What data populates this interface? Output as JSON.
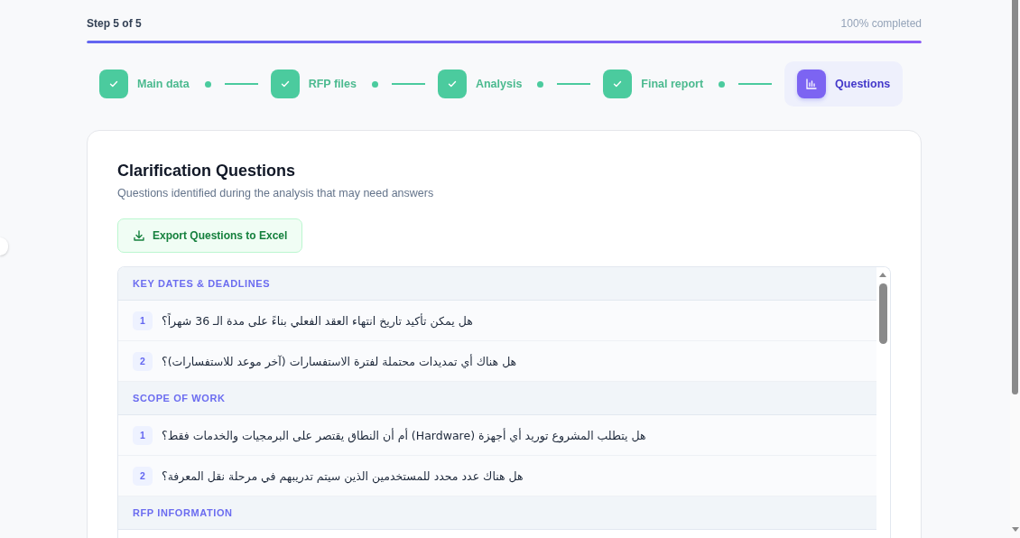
{
  "progress": {
    "step_label": "Step 5 of 5",
    "completion": "100% completed",
    "level": 1
  },
  "steps": [
    {
      "label": "Main data",
      "completed": true,
      "selected": false
    },
    {
      "label": "RFP files",
      "completed": true,
      "selected": false
    },
    {
      "label": "Analysis",
      "completed": true,
      "selected": false
    },
    {
      "label": "Final report",
      "completed": true,
      "selected": false
    },
    {
      "label": "Questions",
      "completed": false,
      "selected": true
    }
  ],
  "card": {
    "title": "Clarification Questions",
    "subtitle": "Questions identified during the analysis that may need answers",
    "export_button": "Export Questions to Excel"
  },
  "sections": [
    {
      "title": "KEY DATES & DEADLINES",
      "questions": [
        {
          "number": "1",
          "text": "هل يمكن تأكيد تاريخ انتهاء العقد الفعلي بناءً على مدة الـ 36 شهراً؟"
        },
        {
          "number": "2",
          "text": "هل هناك أي تمديدات محتملة لفترة الاستفسارات (آخر موعد للاستفسارات)؟"
        }
      ]
    },
    {
      "title": "SCOPE OF WORK",
      "questions": [
        {
          "number": "1",
          "text": "هل يتطلب المشروع توريد أي أجهزة (Hardware) أم أن النطاق يقتصر على البرمجيات والخدمات فقط؟"
        },
        {
          "number": "2",
          "text": "هل هناك عدد محدد للمستخدمين الذين سيتم تدريبهم في مرحلة نقل المعرفة؟"
        }
      ]
    },
    {
      "title": "RFP INFORMATION"
    }
  ]
}
